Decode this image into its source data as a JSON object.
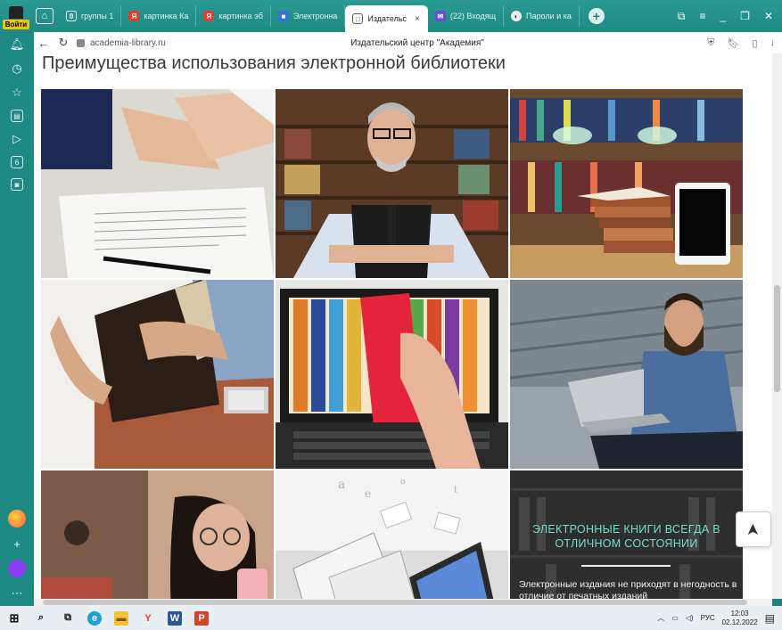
{
  "browser": {
    "signin_label": "Войти",
    "tabs": [
      {
        "label": "группы 1",
        "icon": "0",
        "color": "#6c7a89"
      },
      {
        "label": "картинка Ка",
        "icon": "Я",
        "color": "#e63b2e"
      },
      {
        "label": "картинка эб",
        "icon": "Я",
        "color": "#e63b2e"
      },
      {
        "label": "Электронна",
        "icon": "■",
        "color": "#3b6fd1"
      },
      {
        "label": "Издательс",
        "icon": "□",
        "color": "#ffffff"
      },
      {
        "label": "(22) Входящ",
        "icon": "✉",
        "color": "#6a4bd8"
      },
      {
        "label": "Пароли и ка",
        "icon": "◐",
        "color": "#555555"
      }
    ],
    "active_tab_close": "×",
    "url": "academia-library.ru",
    "page_title": "Издательский центр \"Академия\""
  },
  "page": {
    "heading": "Преимущества использования электронной библиотеки",
    "tile_heading": "ЭЛЕКТРОННЫЕ КНИГИ ВСЕГДА В ОТЛИЧНОМ СОСТОЯНИИ",
    "tile_body": "Электронные издания не приходят в негодность в отличие от печатных изданий",
    "scroll_top_icon": "➤"
  },
  "taskbar": {
    "lang": "РУС",
    "time": "12:03",
    "date": "02.12.2022"
  },
  "colors": {
    "browser_accent": "#1d8a83",
    "tile_heading": "#6fe0cf"
  }
}
